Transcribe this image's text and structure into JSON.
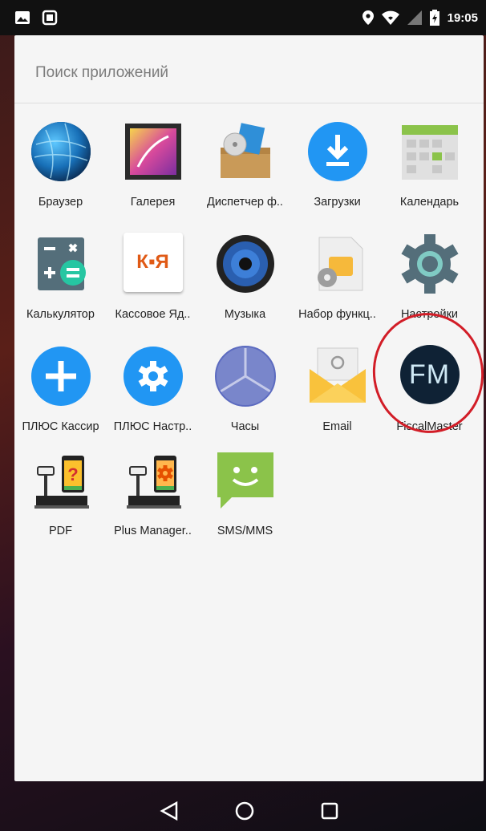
{
  "status_bar": {
    "time": "19:05"
  },
  "search": {
    "placeholder": "Поиск приложений"
  },
  "apps": [
    {
      "label": "Браузер",
      "icon": "globe-icon"
    },
    {
      "label": "Галерея",
      "icon": "gallery-icon"
    },
    {
      "label": "Диспетчер ф..",
      "icon": "file-manager-icon"
    },
    {
      "label": "Загрузки",
      "icon": "download-icon"
    },
    {
      "label": "Календарь",
      "icon": "calendar-icon"
    },
    {
      "label": "Калькулятор",
      "icon": "calculator-icon"
    },
    {
      "label": "Кассовое Яд..",
      "icon": "cash-core-icon"
    },
    {
      "label": "Музыка",
      "icon": "speaker-icon"
    },
    {
      "label": "Набор функц..",
      "icon": "sim-toolkit-icon"
    },
    {
      "label": "Настройки",
      "icon": "settings-gear-icon"
    },
    {
      "label": "ПЛЮС Кассир",
      "icon": "plus-cashier-icon"
    },
    {
      "label": "ПЛЮС Настр..",
      "icon": "plus-settings-icon"
    },
    {
      "label": "Часы",
      "icon": "clock-icon"
    },
    {
      "label": "Email",
      "icon": "email-icon"
    },
    {
      "label": "FiscalMaster",
      "icon": "fm-logo-icon"
    },
    {
      "label": "PDF",
      "icon": "scale-question-icon"
    },
    {
      "label": "Plus Manager..",
      "icon": "scale-gear-icon"
    },
    {
      "label": "SMS/MMS",
      "icon": "sms-icon"
    }
  ],
  "icon_text": {
    "kya": "К▪Я",
    "fm": "FM"
  },
  "colors": {
    "highlight_ring": "#d21d27",
    "drawer_bg": "#f5f5f5"
  }
}
